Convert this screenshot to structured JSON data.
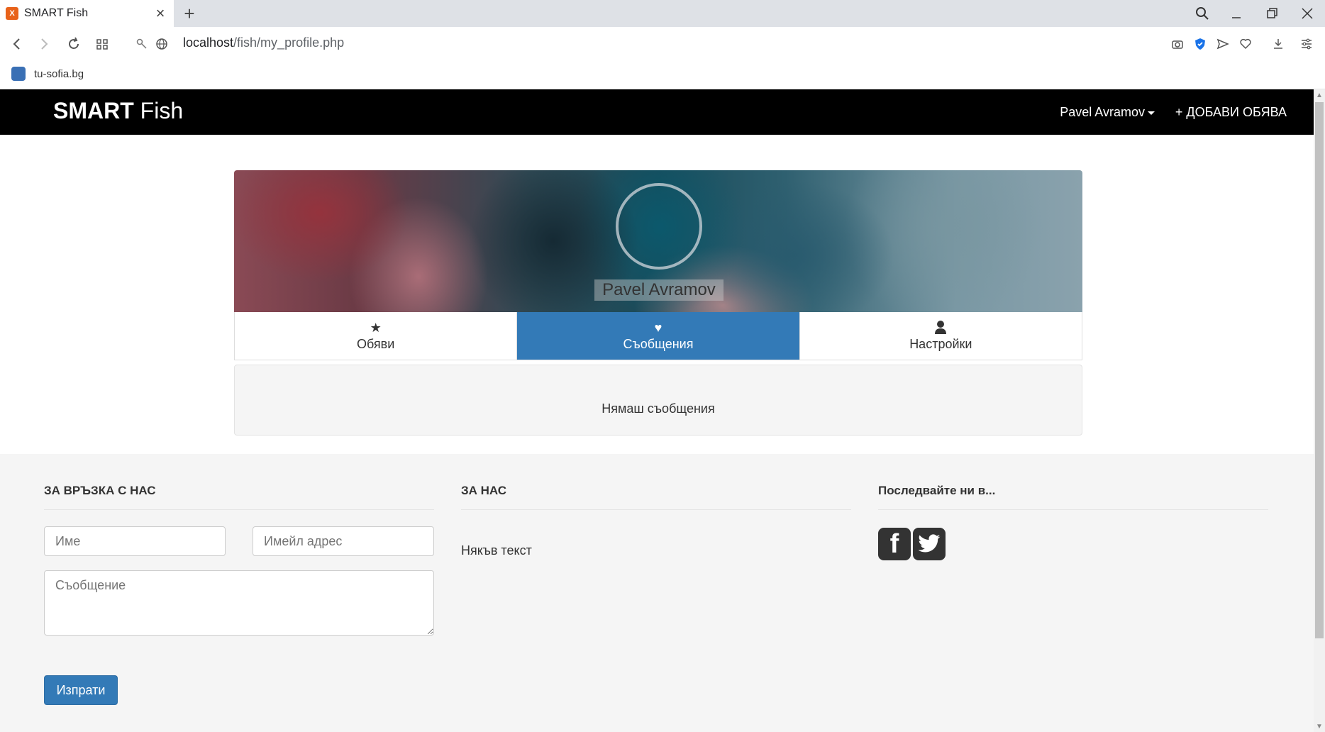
{
  "browser": {
    "tab_title": "SMART Fish",
    "tab_favicon": "xampp-icon",
    "url_host": "localhost",
    "url_path": "/fish/my_profile.php",
    "bookmark_label": "tu-sofia.bg"
  },
  "navbar": {
    "brand_bold": "SMART",
    "brand_light": " Fish",
    "user_label": "Pavel Avramov",
    "add_label": "+ ДОБАВИ ОБЯВА"
  },
  "profile": {
    "name": "Pavel Avramov",
    "tabs": [
      {
        "label": "Обяви",
        "icon": "star-icon",
        "glyph": "★"
      },
      {
        "label": "Съобщения",
        "icon": "heart-icon",
        "glyph": "♥"
      },
      {
        "label": "Настройки",
        "icon": "user-icon",
        "glyph": "👤"
      }
    ],
    "empty_messages": "Нямаш съобщения"
  },
  "footer": {
    "contact_title": "ЗА ВРЪЗКА С НАС",
    "name_placeholder": "Име",
    "email_placeholder": "Имейл адрес",
    "message_placeholder": "Съобщение",
    "send_label": "Изпрати",
    "about_title": "ЗА НАС",
    "about_text": "Някъв текст",
    "follow_title": "Последвайте ни в..."
  },
  "colors": {
    "navbar_bg": "#000000",
    "active_tab": "#337ab7",
    "footer_bg": "#f5f5f5"
  }
}
